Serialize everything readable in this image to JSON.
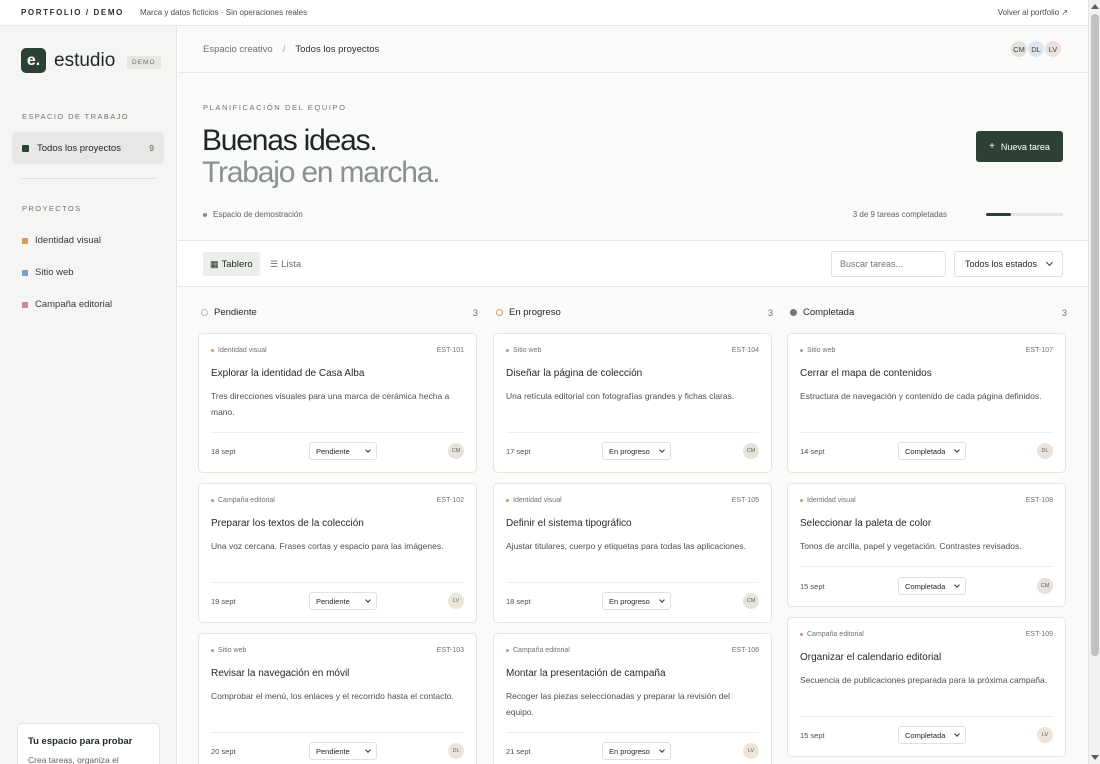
{
  "topbar": {
    "brand": "PORTFOLIO / DEMO",
    "note": "Marca y datos ficticios · Sin operaciones reales",
    "back": "Volver al portfolio ↗"
  },
  "sidebar": {
    "logo_mark": "e.",
    "logo_name": "estudio",
    "demo_badge": "DEMO",
    "workspace_heading": "ESPACIO DE TRABAJO",
    "all_projects": {
      "label": "Todos los proyectos",
      "count": "9"
    },
    "projects_heading": "PROYECTOS",
    "projects": [
      {
        "label": "Identidad visual",
        "color": "#d89a5b"
      },
      {
        "label": "Sitio web",
        "color": "#7e9fc4"
      },
      {
        "label": "Campaña editorial",
        "color": "#c98a93"
      }
    ],
    "try_card": {
      "title": "Tu espacio para probar",
      "desc": "Crea tareas, organiza el"
    }
  },
  "header": {
    "breadcrumb": [
      "Espacio creativo",
      "Todos los proyectos"
    ],
    "breadcrumb_sep": "/",
    "avatars": [
      "CM",
      "DL",
      "LV"
    ],
    "eyebrow": "PLANIFICACIÓN DEL EQUIPO",
    "title_line1": "Buenas ideas.",
    "title_line2": "Trabajo en marcha.",
    "new_task": "Nueva tarea",
    "new_task_icon": "+",
    "demo_space": "Espacio de demostración",
    "progress_text": "3 de 9 tareas completadas",
    "progress_fraction": 0.33
  },
  "toolbar": {
    "board": "Tablero",
    "list": "Lista",
    "search_placeholder": "Buscar tareas...",
    "status_filter": "Todos los estados"
  },
  "columns": [
    {
      "name": "Pendiente",
      "count": "3",
      "cards": [
        {
          "tag": "Identidad visual",
          "code": "EST-101",
          "title": "Explorar la identidad de Casa Alba",
          "desc": "Tres direcciones visuales para una marca de cerámica hecha a mano.",
          "date": "18 sept",
          "status": "Pendiente",
          "avatar": "CM"
        },
        {
          "tag": "Campaña editorial",
          "code": "EST-102",
          "title": "Preparar los textos de la colección",
          "desc": "Una voz cercana. Frases cortas y espacio para las imágenes.",
          "date": "19 sept",
          "status": "Pendiente",
          "avatar": "LV"
        },
        {
          "tag": "Sitio web",
          "code": "EST-103",
          "title": "Revisar la navegación en móvil",
          "desc": "Comprobar el menú, los enlaces y el recorrido hasta el contacto.",
          "date": "20 sept",
          "status": "Pendiente",
          "avatar": "DL"
        }
      ]
    },
    {
      "name": "En progreso",
      "count": "3",
      "cards": [
        {
          "tag": "Sitio web",
          "code": "EST-104",
          "title": "Diseñar la página de colección",
          "desc": "Una retícula editorial con fotografías grandes y fichas claras.",
          "date": "17 sept",
          "status": "En progreso",
          "avatar": "CM"
        },
        {
          "tag": "Identidad visual",
          "code": "EST-105",
          "title": "Definir el sistema tipográfico",
          "desc": "Ajustar titulares, cuerpo y etiquetas para todas las aplicaciones.",
          "date": "18 sept",
          "status": "En progreso",
          "avatar": "CM"
        },
        {
          "tag": "Campaña editorial",
          "code": "EST-106",
          "title": "Montar la presentación de campaña",
          "desc": "Recoger las piezas seleccionadas y preparar la revisión del equipo.",
          "date": "21 sept",
          "status": "En progreso",
          "avatar": "LV"
        }
      ]
    },
    {
      "name": "Completada",
      "count": "3",
      "cards": [
        {
          "tag": "Sitio web",
          "code": "EST-107",
          "title": "Cerrar el mapa de contenidos",
          "desc": "Estructura de navegación y contenido de cada página definidos.",
          "date": "14 sept",
          "status": "Completada",
          "avatar": "DL"
        },
        {
          "tag": "Identidad visual",
          "code": "EST-108",
          "title": "Seleccionar la paleta de color",
          "desc": "Tonos de arcilla, papel y vegetación. Contrastes revisados.",
          "date": "15 sept",
          "status": "Completada",
          "avatar": "CM"
        },
        {
          "tag": "Campaña editorial",
          "code": "EST-109",
          "title": "Organizar el calendario editorial",
          "desc": "Secuencia de publicaciones preparada para la próxima campaña.",
          "date": "15 sept",
          "status": "Completada",
          "avatar": "LV"
        }
      ]
    }
  ],
  "colors": {
    "accent": "#2c4036",
    "tag_identidad": "#d89a5b",
    "tag_web": "#9aa19c",
    "tag_campana": "#c98a93",
    "status_pendiente": "#b9bdb9",
    "status_progreso": "#d89a5b",
    "status_completada": "#6e7a73"
  }
}
